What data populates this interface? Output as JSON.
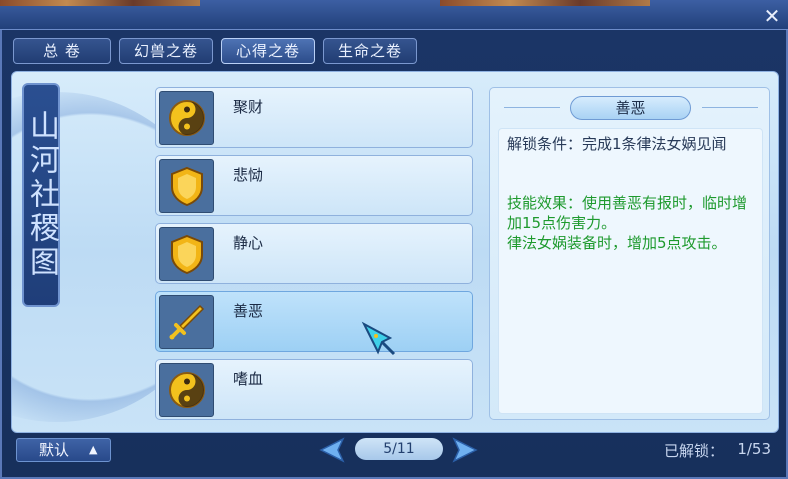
{
  "window": {
    "close_icon": "close-icon"
  },
  "tabs": [
    {
      "label": "总  卷",
      "active": false
    },
    {
      "label": "幻兽之卷",
      "active": false
    },
    {
      "label": "心得之卷",
      "active": true
    },
    {
      "label": "生命之卷",
      "active": false
    }
  ],
  "side_title": "山河社稷图",
  "skills": [
    {
      "name": "聚财",
      "icon": "taiji-icon",
      "selected": false
    },
    {
      "name": "悲恸",
      "icon": "shield-icon",
      "selected": false
    },
    {
      "name": "静心",
      "icon": "shield-icon",
      "selected": false
    },
    {
      "name": "善恶",
      "icon": "sword-icon",
      "selected": true
    },
    {
      "name": "嗜血",
      "icon": "taiji-icon",
      "selected": false
    }
  ],
  "detail": {
    "title": "善恶",
    "condition": "解锁条件：完成1条律法女娲见闻",
    "effect": "技能效果：使用善恶有报时，临时增加15点伤害力。\n律法女娲装备时，增加5点攻击。"
  },
  "footer": {
    "default_label": "默认",
    "default_arrow": "▲",
    "page": "5/11",
    "unlocked_label": "已解锁：",
    "unlocked_count": "1/53"
  },
  "colors": {
    "effect_text": "#1e9a2e",
    "panel_bg": "#c9e3f7",
    "frame_bg": "#17305c"
  }
}
